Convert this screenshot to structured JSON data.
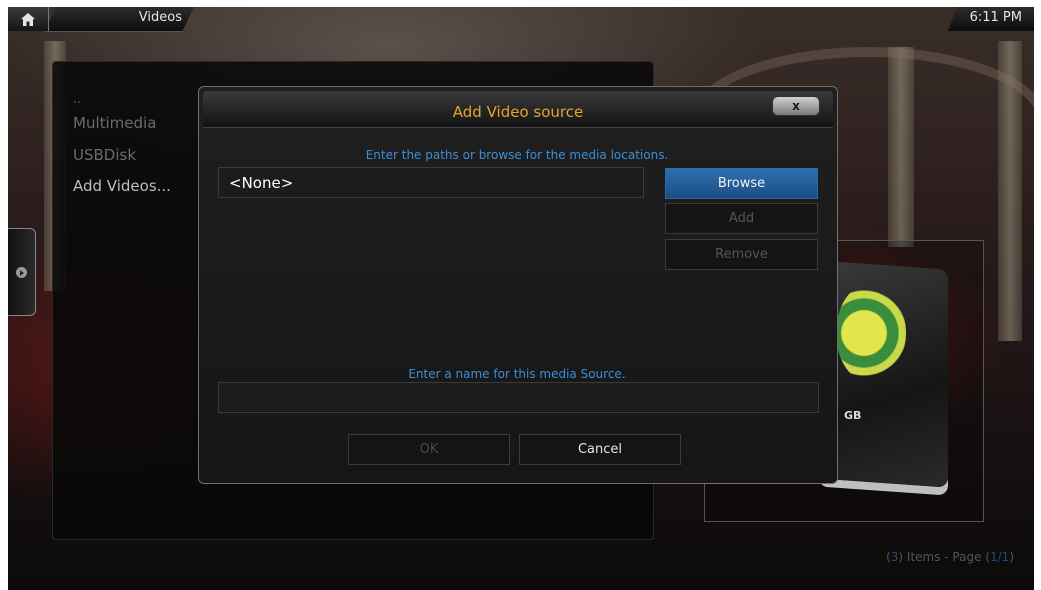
{
  "topbar": {
    "section_title": "Videos",
    "time": "6:11 PM"
  },
  "list": {
    "items": [
      {
        "label": ".."
      },
      {
        "label": "Multimedia"
      },
      {
        "label": "USBDisk"
      },
      {
        "label": "Add Videos..."
      }
    ]
  },
  "thumbnail": {
    "drive_label": "GB"
  },
  "footer": {
    "count": "3",
    "items_text": " Items - Page ",
    "page": "1/1"
  },
  "dialog": {
    "title": "Add Video source",
    "close_label": "x",
    "paths_prompt": "Enter the paths or browse for the media locations.",
    "path_value": "<None>",
    "browse_label": "Browse",
    "add_label": "Add",
    "remove_label": "Remove",
    "name_prompt": "Enter a name for this media Source.",
    "name_value": "",
    "ok_label": "OK",
    "cancel_label": "Cancel"
  },
  "colors": {
    "accent_title": "#e3a32d",
    "prompt_text": "#3b8fd8",
    "focus_button": "#2f6fae"
  }
}
